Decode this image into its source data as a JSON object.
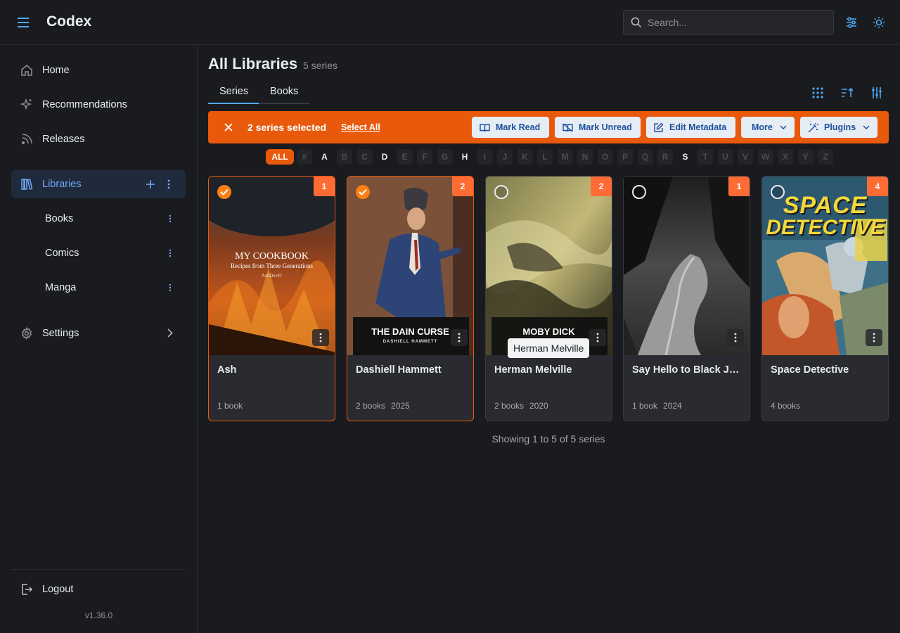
{
  "header": {
    "app_title": "Codex",
    "search_placeholder": "Search..."
  },
  "sidebar": {
    "items": [
      {
        "label": "Home",
        "icon": "home-icon"
      },
      {
        "label": "Recommendations",
        "icon": "sparkles-icon"
      },
      {
        "label": "Releases",
        "icon": "rss-icon"
      },
      {
        "label": "Libraries",
        "icon": "libraries-icon",
        "active": true
      }
    ],
    "libraries": [
      {
        "label": "Books"
      },
      {
        "label": "Comics"
      },
      {
        "label": "Manga"
      }
    ],
    "settings_label": "Settings",
    "logout_label": "Logout",
    "version": "v1.36.0"
  },
  "main": {
    "title": "All Libraries",
    "count": "5 series",
    "tabs": [
      {
        "label": "Series",
        "active": true
      },
      {
        "label": "Books",
        "active": false
      }
    ],
    "selection": {
      "text": "2 series selected",
      "select_all": "Select All",
      "buttons": {
        "mark_read": "Mark Read",
        "mark_unread": "Mark Unread",
        "edit_metadata": "Edit Metadata",
        "more": "More",
        "plugins": "Plugins"
      }
    },
    "alphabet": {
      "all": "ALL",
      "letters": [
        "#",
        "A",
        "B",
        "C",
        "D",
        "E",
        "F",
        "G",
        "H",
        "I",
        "J",
        "K",
        "L",
        "M",
        "N",
        "O",
        "P",
        "Q",
        "R",
        "S",
        "T",
        "U",
        "V",
        "W",
        "X",
        "Y",
        "Z"
      ],
      "enabled": [
        "A",
        "D",
        "H",
        "S"
      ]
    },
    "cards": [
      {
        "title": "Ash",
        "badge": "1",
        "books": "1 book",
        "year": "",
        "selected": true,
        "cover_title": "MY COOKBOOK",
        "cover_sub": "Recipes from Three Generations",
        "cover_author": "AshDevFr"
      },
      {
        "title": "Dashiell Hammett",
        "badge": "2",
        "books": "2 books",
        "year": "2025",
        "selected": true,
        "cover_title": "THE DAIN CURSE",
        "cover_author": "DASHIELL HAMMETT"
      },
      {
        "title": "Herman Melville",
        "badge": "2",
        "books": "2 books",
        "year": "2020",
        "selected": false,
        "cover_title": "MOBY DICK"
      },
      {
        "title": "Say Hello to Black Jack",
        "badge": "1",
        "books": "1 book",
        "year": "2024",
        "selected": false
      },
      {
        "title": "Space Detective",
        "badge": "4",
        "books": "4 books",
        "year": "",
        "selected": false,
        "cover_title_1": "SPACE",
        "cover_title_2": "DETECTIVE"
      }
    ],
    "tooltip": "Herman Melville",
    "showing": "Showing 1 to 5 of 5 series"
  },
  "colors": {
    "accent": "#e8590c",
    "link": "#74a9f8",
    "badge": "#ff6b35"
  }
}
